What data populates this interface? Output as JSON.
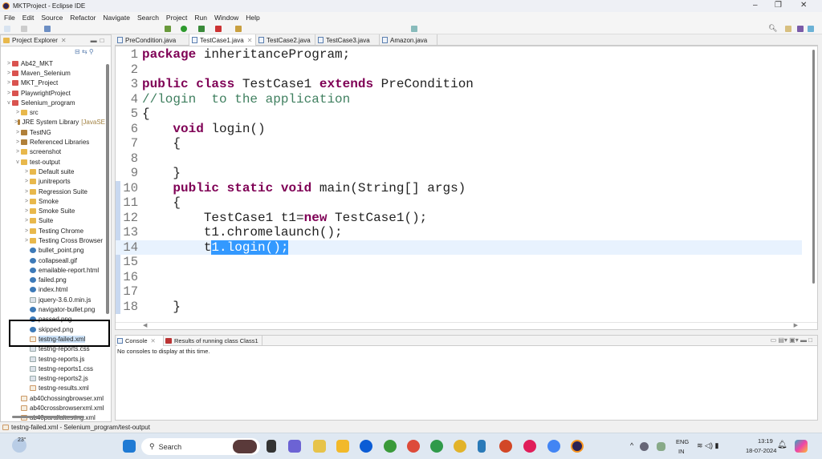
{
  "window": {
    "title": "MKTProject - Eclipse IDE",
    "minimize": "–",
    "maximize": "❐",
    "close": "✕"
  },
  "menu": [
    "File",
    "Edit",
    "Source",
    "Refactor",
    "Navigate",
    "Search",
    "Project",
    "Run",
    "Window",
    "Help"
  ],
  "project_explorer": {
    "title": "Project Explorer",
    "items": [
      {
        "label": "Ab42_MKT",
        "depth": 0,
        "icon": "project",
        "arrow": ">"
      },
      {
        "label": "Maven_Selenium",
        "depth": 0,
        "icon": "project",
        "arrow": ">"
      },
      {
        "label": "MKT_Project",
        "depth": 0,
        "icon": "project",
        "arrow": ">"
      },
      {
        "label": "PlaywrightProject",
        "depth": 0,
        "icon": "project",
        "arrow": ">"
      },
      {
        "label": "Selenium_program",
        "depth": 0,
        "icon": "project",
        "arrow": "v"
      },
      {
        "label": "src",
        "depth": 1,
        "icon": "folder",
        "arrow": ">"
      },
      {
        "label": "JRE System Library",
        "suffix": "[JavaSE",
        "depth": 1,
        "icon": "library",
        "arrow": ">"
      },
      {
        "label": "TestNG",
        "depth": 1,
        "icon": "library",
        "arrow": ">"
      },
      {
        "label": "Referenced Libraries",
        "depth": 1,
        "icon": "library",
        "arrow": ">"
      },
      {
        "label": "screenshot",
        "depth": 1,
        "icon": "folder",
        "arrow": ">"
      },
      {
        "label": "test-output",
        "depth": 1,
        "icon": "folder",
        "arrow": "v"
      },
      {
        "label": "Default suite",
        "depth": 2,
        "icon": "folder",
        "arrow": ">"
      },
      {
        "label": "junitreports",
        "depth": 2,
        "icon": "folder",
        "arrow": ">"
      },
      {
        "label": "Regression Suite",
        "depth": 2,
        "icon": "folder",
        "arrow": ">"
      },
      {
        "label": "Smoke",
        "depth": 2,
        "icon": "folder",
        "arrow": ">"
      },
      {
        "label": "Smoke Suite",
        "depth": 2,
        "icon": "folder",
        "arrow": ">"
      },
      {
        "label": "Suite",
        "depth": 2,
        "icon": "folder",
        "arrow": ">"
      },
      {
        "label": "Testing Chrome",
        "depth": 2,
        "icon": "folder",
        "arrow": ">"
      },
      {
        "label": "Testing Cross Browser",
        "depth": 2,
        "icon": "folder",
        "arrow": ">"
      },
      {
        "label": "bullet_point.png",
        "depth": 2,
        "icon": "globe",
        "arrow": ""
      },
      {
        "label": "collapseall.gif",
        "depth": 2,
        "icon": "globe",
        "arrow": ""
      },
      {
        "label": "emailable-report.html",
        "depth": 2,
        "icon": "globe",
        "arrow": ""
      },
      {
        "label": "failed.png",
        "depth": 2,
        "icon": "globe",
        "arrow": ""
      },
      {
        "label": "index.html",
        "depth": 2,
        "icon": "globe",
        "arrow": ""
      },
      {
        "label": "jquery-3.6.0.min.js",
        "depth": 2,
        "icon": "file",
        "arrow": ""
      },
      {
        "label": "navigator-bullet.png",
        "depth": 2,
        "icon": "globe",
        "arrow": ""
      },
      {
        "label": "passed.png",
        "depth": 2,
        "icon": "globe",
        "arrow": ""
      },
      {
        "label": "skipped.png",
        "depth": 2,
        "icon": "globe",
        "arrow": ""
      },
      {
        "label": "testng-failed.xml",
        "depth": 2,
        "icon": "xml",
        "arrow": "",
        "selected": true
      },
      {
        "label": "testng-reports.css",
        "depth": 2,
        "icon": "file",
        "arrow": ""
      },
      {
        "label": "testng-reports.js",
        "depth": 2,
        "icon": "file",
        "arrow": ""
      },
      {
        "label": "testng-reports1.css",
        "depth": 2,
        "icon": "file",
        "arrow": ""
      },
      {
        "label": "testng-reports2.js",
        "depth": 2,
        "icon": "file",
        "arrow": ""
      },
      {
        "label": "testng-results.xml",
        "depth": 2,
        "icon": "xml",
        "arrow": ""
      },
      {
        "label": "ab40chossingbrowser.xml",
        "depth": 1,
        "icon": "xml",
        "arrow": ""
      },
      {
        "label": "ab40crossbrowserxml.xml",
        "depth": 1,
        "icon": "xml",
        "arrow": ""
      },
      {
        "label": "ab40parallaltesting.xml",
        "depth": 1,
        "icon": "xml",
        "arrow": ""
      }
    ]
  },
  "editor_tabs": [
    {
      "label": "PreCondition.java",
      "active": false
    },
    {
      "label": "TestCase1.java",
      "active": true
    },
    {
      "label": "TestCase2.java",
      "active": false
    },
    {
      "label": "TestCase3.java",
      "active": false
    },
    {
      "label": "Amazon.java",
      "active": false
    }
  ],
  "code_lines": [
    {
      "n": "1",
      "segs": [
        [
          "kw",
          "package"
        ],
        [
          "",
          " inheritanceProgram;"
        ]
      ]
    },
    {
      "n": "2",
      "segs": []
    },
    {
      "n": "3",
      "segs": [
        [
          "kw",
          "public"
        ],
        [
          "",
          " "
        ],
        [
          "kw",
          "class"
        ],
        [
          "",
          " TestCase1 "
        ],
        [
          "kw",
          "extends"
        ],
        [
          "",
          " PreCondition"
        ]
      ]
    },
    {
      "n": "4",
      "segs": [
        [
          "cm",
          "//login  to the application"
        ]
      ]
    },
    {
      "n": "5",
      "segs": [
        [
          "",
          "{"
        ]
      ]
    },
    {
      "n": "6",
      "segs": [
        [
          "",
          "    "
        ],
        [
          "kw",
          "void"
        ],
        [
          "",
          " login()"
        ]
      ]
    },
    {
      "n": "7",
      "segs": [
        [
          "",
          "    {"
        ]
      ]
    },
    {
      "n": "8",
      "segs": []
    },
    {
      "n": "9",
      "segs": [
        [
          "",
          "    }"
        ]
      ]
    },
    {
      "n": "10",
      "segs": [
        [
          "",
          "    "
        ],
        [
          "kw",
          "public"
        ],
        [
          "",
          " "
        ],
        [
          "kw",
          "static"
        ],
        [
          "",
          " "
        ],
        [
          "kw",
          "void"
        ],
        [
          "",
          " main(String[] args)"
        ]
      ]
    },
    {
      "n": "11",
      "segs": [
        [
          "",
          "    {"
        ]
      ]
    },
    {
      "n": "12",
      "segs": [
        [
          "",
          "        TestCase1 t1="
        ],
        [
          "kw",
          "new"
        ],
        [
          "",
          " TestCase1();"
        ]
      ]
    },
    {
      "n": "13",
      "segs": [
        [
          "",
          "        t1.chromelaunch();"
        ]
      ]
    },
    {
      "n": "14",
      "segs": [
        [
          "",
          "        t"
        ],
        [
          "hl",
          "1.login();"
        ]
      ],
      "current": true
    },
    {
      "n": "15",
      "segs": []
    },
    {
      "n": "16",
      "segs": []
    },
    {
      "n": "17",
      "segs": []
    },
    {
      "n": "18",
      "segs": [
        [
          "",
          "    }"
        ]
      ]
    }
  ],
  "console": {
    "tab": "Console",
    "tab2": "Results of running class Class1",
    "message": "No consoles to display at this time."
  },
  "status": "testng-failed.xml - Selenium_program/test-output",
  "taskbar": {
    "weather": "23°",
    "search": "Search",
    "lang1": "ENG",
    "lang2": "IN",
    "time": "13:19",
    "date": "18-07-2024"
  }
}
